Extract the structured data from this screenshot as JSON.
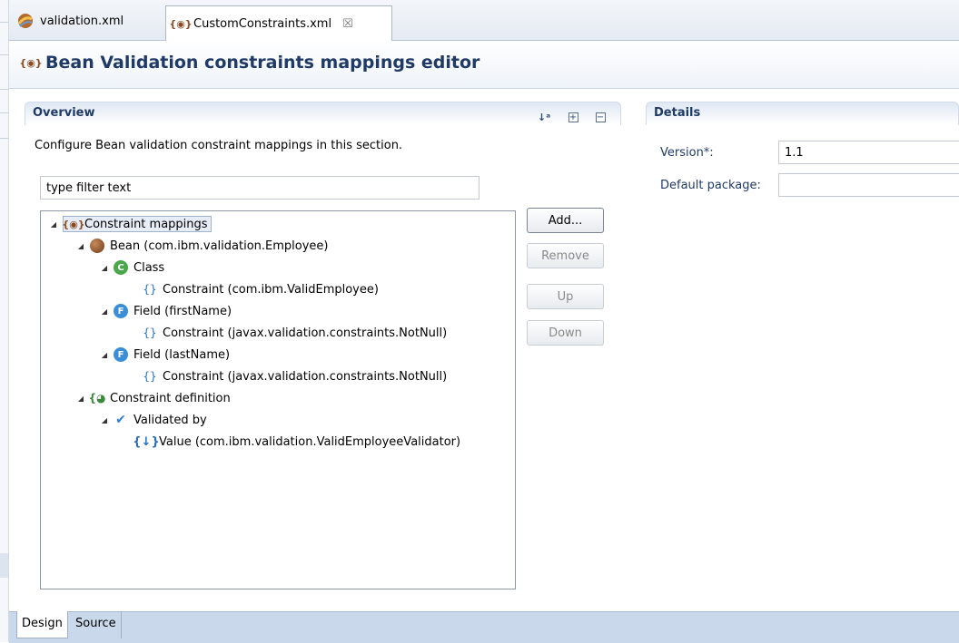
{
  "tabs": [
    {
      "label": "validation.xml"
    },
    {
      "label": "CustomConstraints.xml"
    }
  ],
  "editor": {
    "title": "Bean Validation constraints mappings editor"
  },
  "overview": {
    "heading": "Overview",
    "description": "Configure Bean validation constraint mappings in this section.",
    "filter_value": "type filter text",
    "tree": [
      {
        "label": "Constraint mappings",
        "icon": "constraint-mappings-icon"
      },
      {
        "label": "Bean (com.ibm.validation.Employee)",
        "icon": "bean-icon"
      },
      {
        "label": "Class",
        "icon": "class-icon"
      },
      {
        "label": "Constraint (com.ibm.ValidEmployee)",
        "icon": "braces-icon"
      },
      {
        "label": "Field (firstName)",
        "icon": "field-icon"
      },
      {
        "label": "Constraint (javax.validation.constraints.NotNull)",
        "icon": "braces-icon"
      },
      {
        "label": "Field (lastName)",
        "icon": "field-icon"
      },
      {
        "label": "Constraint (javax.validation.constraints.NotNull)",
        "icon": "braces-icon"
      },
      {
        "label": "Constraint definition",
        "icon": "constraint-definition-icon"
      },
      {
        "label": "Validated by",
        "icon": "validated-by-icon"
      },
      {
        "label": "Value (com.ibm.validation.ValidEmployeeValidator)",
        "icon": "value-icon"
      }
    ],
    "buttons": {
      "add": "Add...",
      "remove": "Remove",
      "up": "Up",
      "down": "Down"
    }
  },
  "details": {
    "heading": "Details",
    "version_label": "Version*:",
    "version_value": "1.1",
    "default_package_label": "Default package:",
    "default_package_value": ""
  },
  "bottom_tabs": {
    "design": "Design",
    "source": "Source"
  },
  "glyphs": {
    "close": "☒",
    "expanded": "◢",
    "mapping_icon": "{◉}",
    "class_icon": "C",
    "field_icon": "F",
    "braces_icon": "{}",
    "def_icon": "{◕",
    "validated_icon": "✔",
    "value_icon": "{↓}",
    "sort": "↓ᵃ",
    "expand_all": "+",
    "collapse_all": "−"
  }
}
